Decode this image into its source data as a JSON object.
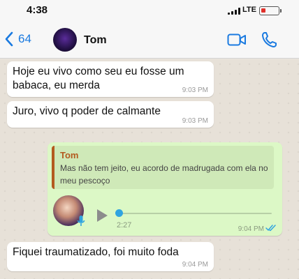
{
  "status": {
    "time": "4:38",
    "network": "LTE"
  },
  "header": {
    "back_count": "64",
    "contact_name": "Tom"
  },
  "messages": [
    {
      "text": "Hoje eu vivo como seu eu fosse um babaca, eu merda",
      "time": "9:03 PM"
    },
    {
      "text": "Juro, vivo q poder de calmante",
      "time": "9:03 PM"
    },
    {
      "quote_name": "Tom",
      "quote_text": "Mas não tem jeito, eu acordo de madrugada com ela no meu pescoço",
      "voice_duration": "2:27",
      "time": "9:04 PM"
    },
    {
      "text": "Fiquei traumatizado, foi muito foda",
      "time": "9:04 PM"
    }
  ],
  "colors": {
    "accent": "#1a7ae0",
    "outgoing_bubble": "#dcf8c6",
    "incoming_bubble": "#ffffff",
    "quote_name": "#b35a1f",
    "read_ticks": "#30a4e0",
    "battery_low": "#e0302a"
  },
  "icons": [
    "back-chevron-icon",
    "video-call-icon",
    "phone-icon",
    "play-icon",
    "mic-icon",
    "read-receipt-icon",
    "signal-icon",
    "battery-icon"
  ]
}
